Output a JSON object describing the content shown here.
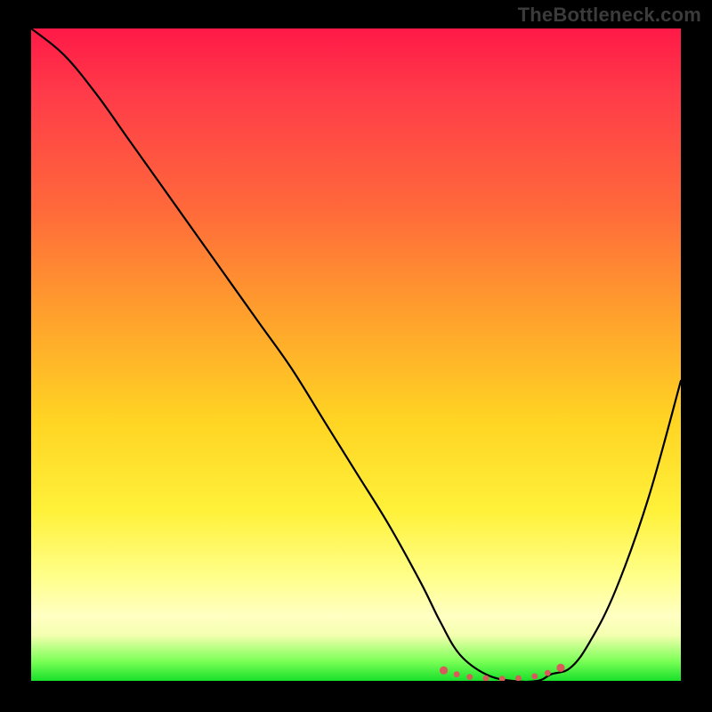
{
  "watermark": "TheBottleneck.com",
  "chart_data": {
    "type": "line",
    "title": "",
    "xlabel": "",
    "ylabel": "",
    "xlim": [
      0,
      100
    ],
    "ylim": [
      0,
      100
    ],
    "grid": false,
    "legend": false,
    "colors": {
      "curve": "#000000",
      "accent_dots": "#d85a5a",
      "gradient_top": "#ff1947",
      "gradient_mid": "#ffe23a",
      "gradient_bottom": "#18e02a"
    },
    "series": [
      {
        "name": "bottleneck-curve",
        "x": [
          0,
          5,
          10,
          15,
          20,
          25,
          30,
          35,
          40,
          45,
          50,
          55,
          60,
          63,
          66,
          70,
          74,
          78,
          80,
          83,
          86,
          90,
          95,
          100
        ],
        "y": [
          100,
          96,
          90,
          83,
          76,
          69,
          62,
          55,
          48,
          40,
          32,
          24,
          15,
          9,
          4,
          1,
          0,
          0,
          1,
          2,
          6,
          14,
          28,
          46
        ]
      }
    ],
    "accent_points": {
      "name": "minimum-band-dots",
      "x": [
        63.5,
        65.5,
        67.5,
        70.0,
        72.5,
        75.0,
        77.5,
        79.5,
        81.5
      ],
      "y": [
        1.6,
        1.0,
        0.6,
        0.4,
        0.3,
        0.4,
        0.7,
        1.2,
        2.0
      ]
    }
  }
}
